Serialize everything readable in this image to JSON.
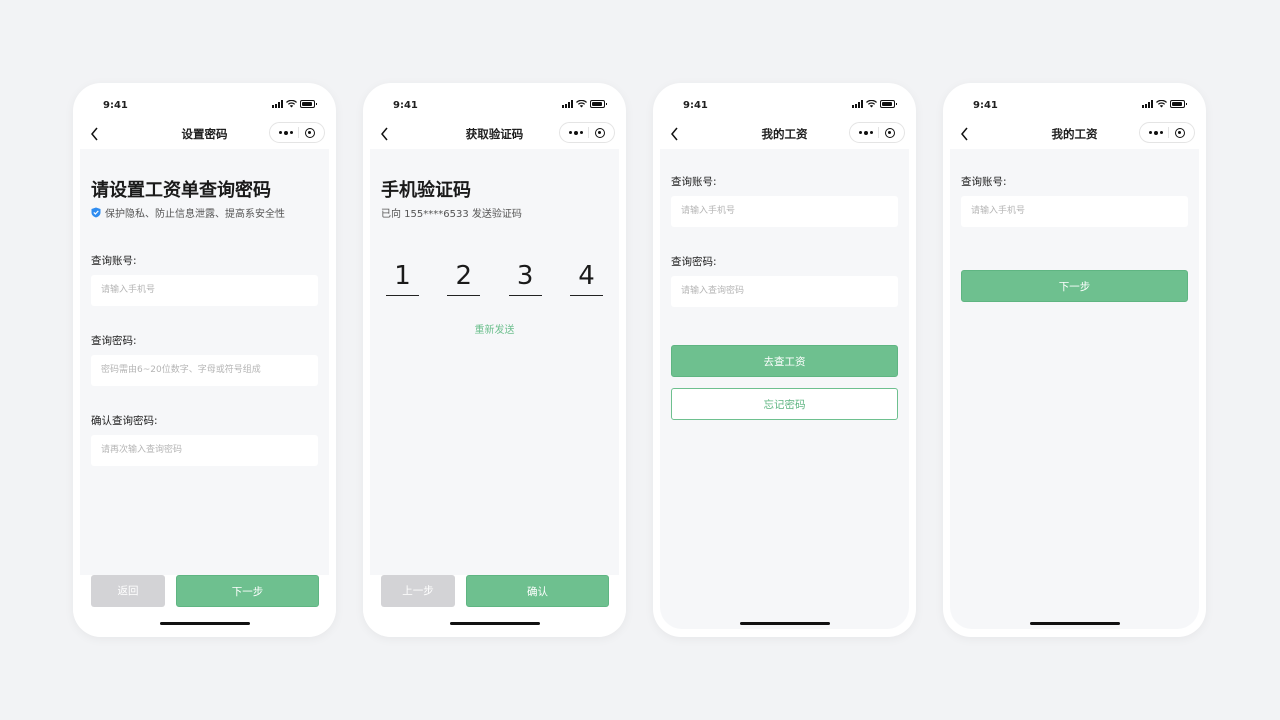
{
  "status_time": "9:41",
  "screens": [
    {
      "nav_title": "设置密码",
      "title": "请设置工资单查询密码",
      "subtitle": "保护隐私、防止信息泄露、提高系安全性",
      "fields": [
        {
          "label": "查询账号:",
          "placeholder": "请输入手机号"
        },
        {
          "label": "查询密码:",
          "placeholder": "密码需由6~20位数字、字母或符号组成"
        },
        {
          "label": "确认查询密码:",
          "placeholder": "请再次输入查询密码"
        }
      ],
      "buttons": {
        "left": "返回",
        "right": "下一步"
      }
    },
    {
      "nav_title": "获取验证码",
      "title": "手机验证码",
      "subtitle": "已向 155****6533 发送验证码",
      "code_digits": [
        "1",
        "2",
        "3",
        "4"
      ],
      "resend": "重新发送",
      "buttons": {
        "left": "上一步",
        "right": "确认"
      }
    },
    {
      "nav_title": "我的工资",
      "fields": [
        {
          "label": "查询账号:",
          "placeholder": "请输入手机号"
        },
        {
          "label": "查询密码:",
          "placeholder": "请输入查询密码"
        }
      ],
      "buttons": {
        "primary": "去查工资",
        "secondary": "忘记密码"
      }
    },
    {
      "nav_title": "我的工资",
      "fields": [
        {
          "label": "查询账号:",
          "placeholder": "请输入手机号"
        }
      ],
      "buttons": {
        "primary": "下一步"
      }
    }
  ],
  "colors": {
    "accent": "#6ec08f",
    "disabled": "#d3d3d6",
    "background": "#f2f3f5",
    "shield": "#2f8cf0"
  },
  "icons": [
    "back-arrow-icon",
    "more-dots-icon",
    "close-target-icon",
    "signal-icon",
    "wifi-icon",
    "battery-icon",
    "shield-check-icon"
  ]
}
